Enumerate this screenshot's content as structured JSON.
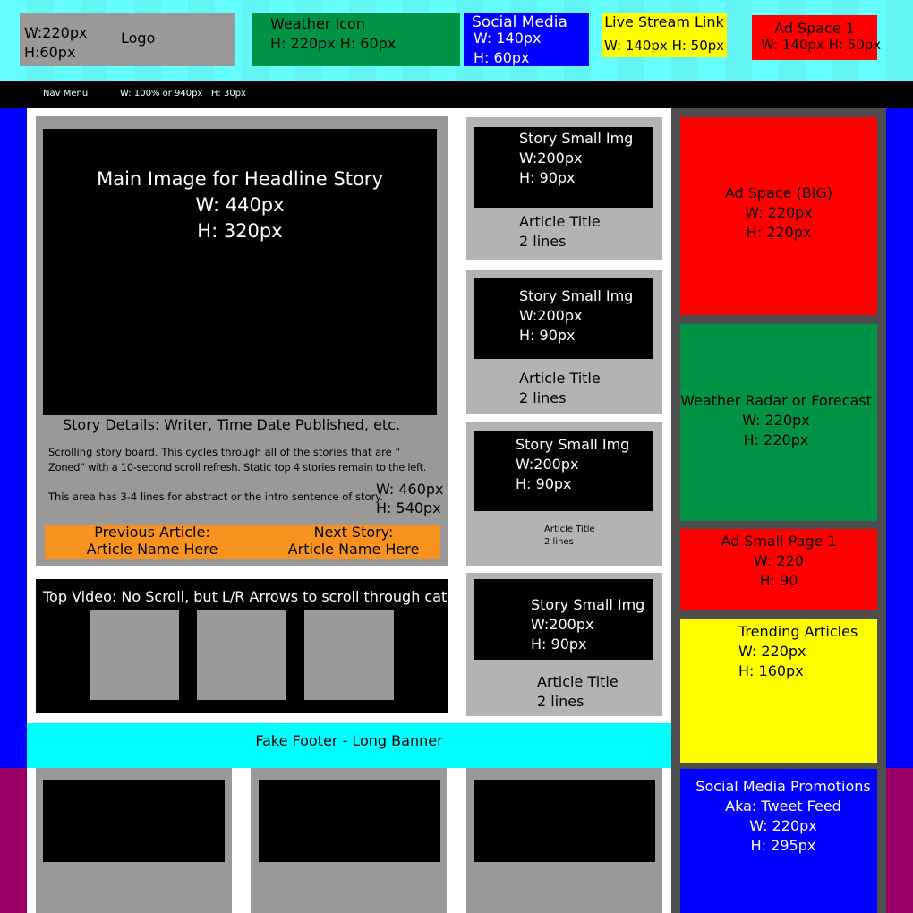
{
  "header": {
    "logo": {
      "size_w": "W:220px",
      "size_h": "H:60px",
      "label": "Logo"
    },
    "weather_icon": {
      "label": "Weather Icon",
      "size": "H: 220px H: 60px"
    },
    "social_media": {
      "label": "Social Media",
      "size_w": "W: 140px",
      "size_h": "H: 60px"
    },
    "live_stream": {
      "label": "Live Stream Link",
      "size": "W: 140px H: 50px"
    },
    "ad_space_1": {
      "label": "Ad Space 1",
      "size": "W: 140px H: 50px"
    }
  },
  "nav": {
    "label": "Nav Menu",
    "size": "W: 100% or 940px   H: 30px"
  },
  "main_story": {
    "image_title": "Main Image for Headline Story",
    "image_w": "W: 440px",
    "image_h": "H: 320px",
    "details": "Story Details: Writer, Time Date Published, etc.",
    "desc_1": "Scrolling story board. This cycles through all of the stories that are “",
    "desc_2": "Zoned” with a 10-second scroll refresh. Static top 4 stories remain to the left.",
    "desc_3": "This area has 3-4 lines for abstract or the intro sentence of story.",
    "size_w": "W: 460px",
    "size_h": "H: 540px",
    "prev_label": "Previous Article:",
    "prev_name": "Article Name Here",
    "next_label": "Next Story:",
    "next_name": "Article Name Here"
  },
  "video": {
    "label": "Top Video: No Scroll, but L/R Arrows to scroll through catalog"
  },
  "small_stories": [
    {
      "img": "Story Small Img",
      "w": "W:200px",
      "h": "H: 90px",
      "title": "Article Title",
      "lines": "2 lines"
    },
    {
      "img": "Story Small Img",
      "w": "W:200px",
      "h": "H: 90px",
      "title": "Article Title",
      "lines": "2 lines"
    },
    {
      "img": "Story Small Img",
      "w": "W:200px",
      "h": "H: 90px",
      "title": "Article Title",
      "lines": "2 lines"
    },
    {
      "img": "Story Small Img",
      "w": "W:200px",
      "h": "H: 90px",
      "title": "Article Title",
      "lines": "2 lines"
    }
  ],
  "footer": {
    "label": "Fake Footer - Long Banner"
  },
  "sidebar": {
    "ad_big": {
      "label": "Ad Space (BIG)",
      "w": "W: 220px",
      "h": "H: 220px"
    },
    "weather": {
      "label": "Weather Radar or Forecast",
      "w": "W: 220px",
      "h": "H: 220px"
    },
    "ad_small": {
      "label": "Ad Small Page 1",
      "w": "W: 220",
      "h": "H: 90"
    },
    "trending": {
      "label": "Trending Articles",
      "w": "W: 220px",
      "h": "H: 160px"
    },
    "social": {
      "label": "Social Media Promotions",
      "sub": "Aka: Tweet Feed",
      "w": "W: 220px",
      "h": "H: 295px"
    }
  },
  "colors": {
    "cyan": "#66ffff",
    "green": "#009245",
    "blue": "#0000ff",
    "yellow": "#ffff00",
    "red": "#ff0000",
    "orange": "#f7931e",
    "magenta": "#990066",
    "gray": "#999999"
  }
}
